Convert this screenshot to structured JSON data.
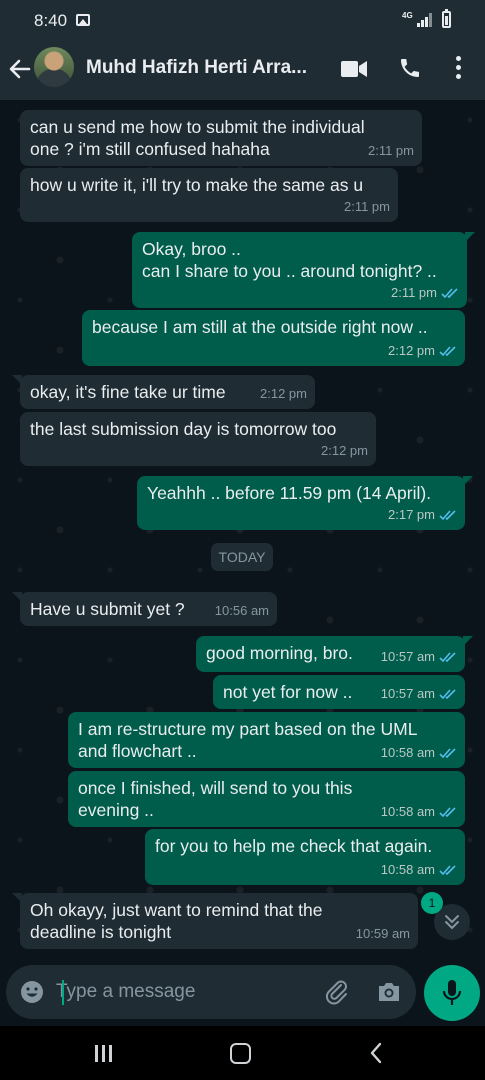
{
  "status_bar": {
    "time": "8:40",
    "network": "4G"
  },
  "header": {
    "contact_name": "Muhd Hafizh Herti Arra..."
  },
  "date_divider": "TODAY",
  "messages": [
    {
      "dir": "in",
      "lines": [
        "can u send me how to submit the individual",
        "one ? i'm still confused hahaha"
      ],
      "time": "2:11 pm"
    },
    {
      "dir": "in",
      "lines": [
        "how u write it, i'll try to make the same as u"
      ],
      "time": "2:11 pm"
    },
    {
      "dir": "out",
      "lines": [
        "Okay, broo ..",
        "can I share to you .. around tonight? .."
      ],
      "time": "2:11 pm"
    },
    {
      "dir": "out",
      "lines": [
        "because I am still at the outside right now .."
      ],
      "time": "2:12 pm"
    },
    {
      "dir": "in",
      "lines": [
        "okay, it's fine take ur time"
      ],
      "time": "2:12 pm"
    },
    {
      "dir": "in",
      "lines": [
        "the last submission day is tomorrow too"
      ],
      "time": "2:12 pm"
    },
    {
      "dir": "out",
      "lines": [
        "Yeahhh .. before 11.59 pm (14 April)."
      ],
      "time": "2:17 pm"
    },
    {
      "dir": "in",
      "lines": [
        "Have u submit yet ?"
      ],
      "time": "10:56 am"
    },
    {
      "dir": "out",
      "lines": [
        "good morning, bro."
      ],
      "time": "10:57 am"
    },
    {
      "dir": "out",
      "lines": [
        "not yet for now .."
      ],
      "time": "10:57 am"
    },
    {
      "dir": "out",
      "lines": [
        "I am re-structure my part based on the UML",
        "and flowchart .."
      ],
      "time": "10:58 am"
    },
    {
      "dir": "out",
      "lines": [
        "once I finished, will send to you this",
        "evening .."
      ],
      "time": "10:58 am"
    },
    {
      "dir": "out",
      "lines": [
        "for you to help me check that again."
      ],
      "time": "10:58 am"
    },
    {
      "dir": "in",
      "lines": [
        "Oh okayy, just want to remind that the",
        "deadline is tonight"
      ],
      "time": "10:59 am"
    }
  ],
  "unread_count": "1",
  "composer": {
    "placeholder": "Type a message"
  },
  "colors": {
    "accent": "#00a884",
    "outgoing_bubble": "#005c4b",
    "incoming_bubble": "#1f2c34",
    "read_tick": "#53bdeb"
  }
}
